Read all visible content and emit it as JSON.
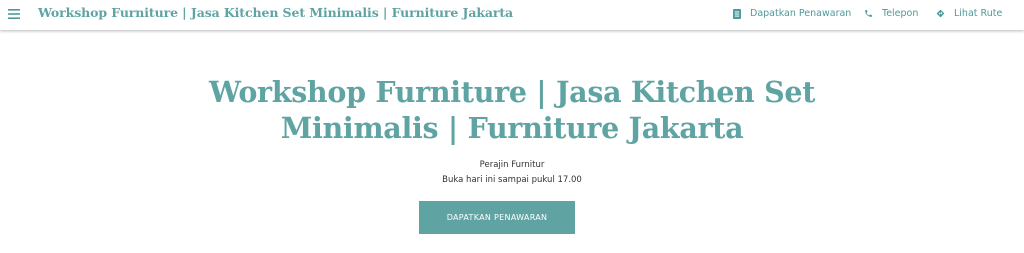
{
  "header": {
    "menu_icon": "hamburger-menu-icon",
    "site_title": "Workshop Furniture | Jasa Kitchen Set Minimalis | Furniture Jakarta",
    "nav": [
      {
        "label": "Dapatkan Penawaran",
        "icon": "receipt-icon"
      },
      {
        "label": "Telepon",
        "icon": "phone-icon"
      },
      {
        "label": "Lihat Rute",
        "icon": "directions-icon"
      }
    ]
  },
  "hero": {
    "title_line1": "Workshop Furniture | Jasa Kitchen Set",
    "title_line2": "Minimalis | Furniture Jakarta",
    "category": "Perajin Furnitur",
    "hours": "Buka hari ini sampai pukul 17.00",
    "cta_label": "DAPATKAN PENAWARAN"
  },
  "colors": {
    "accent": "#5fa3a3",
    "text": "#333333",
    "background": "#ffffff"
  }
}
